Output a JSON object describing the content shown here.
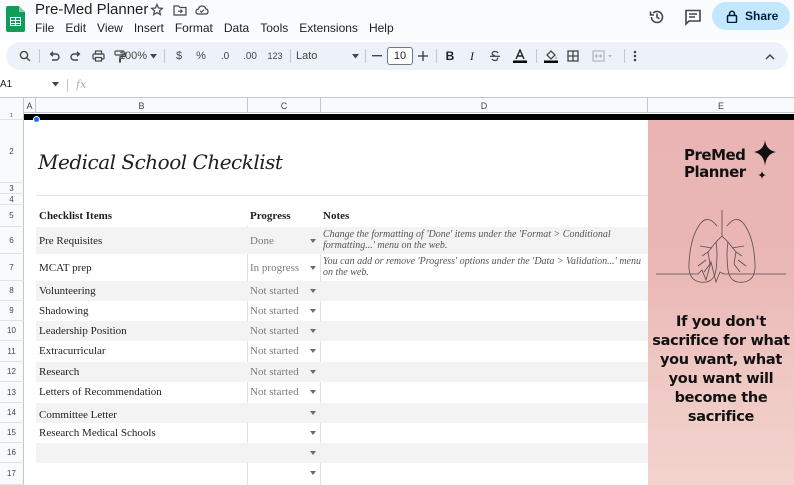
{
  "app": {
    "title": "Pre-Med Planner",
    "share_label": "Share",
    "menu": [
      "File",
      "Edit",
      "View",
      "Insert",
      "Format",
      "Data",
      "Tools",
      "Extensions",
      "Help"
    ]
  },
  "toolbar": {
    "zoom": "100%",
    "currency": "$",
    "percent": "%",
    "decrease_decimals": ".0",
    "increase_decimals": ".00",
    "number_format": "123",
    "font": "Lato",
    "font_size": "10",
    "bold": "B",
    "italic": "I"
  },
  "formula_bar": {
    "name_box": "A1",
    "fx": "fx"
  },
  "columns": [
    "A",
    "B",
    "C",
    "D",
    "E"
  ],
  "rows": [
    "1",
    "2",
    "3",
    "4",
    "5",
    "6",
    "7",
    "8",
    "9",
    "10",
    "11",
    "12",
    "13",
    "14",
    "15",
    "16",
    "17"
  ],
  "sheet": {
    "title": "Medical School Checklist",
    "headers": {
      "items": "Checklist Items",
      "progress": "Progress",
      "notes": "Notes"
    },
    "entries": [
      {
        "item": "Pre Requisites",
        "progress": "Done",
        "note": "Change the formatting of 'Done' items under the 'Format > Conditional formatting...' menu on the web."
      },
      {
        "item": "MCAT prep",
        "progress": "In progress",
        "note": "You can add or remove 'Progress' options under the 'Data > Validation...' menu on the web."
      },
      {
        "item": "Volunteering",
        "progress": "Not started",
        "note": ""
      },
      {
        "item": "Shadowing",
        "progress": "Not started",
        "note": ""
      },
      {
        "item": "Leadership Position",
        "progress": "Not started",
        "note": ""
      },
      {
        "item": "Extracurricular",
        "progress": "Not started",
        "note": ""
      },
      {
        "item": "Research",
        "progress": "Not started",
        "note": ""
      },
      {
        "item": "Letters of Recommendation",
        "progress": "Not started",
        "note": ""
      },
      {
        "item": "Committee Letter",
        "progress": "",
        "note": ""
      },
      {
        "item": "Research Medical Schools",
        "progress": "",
        "note": ""
      },
      {
        "item": "",
        "progress": "",
        "note": ""
      },
      {
        "item": "",
        "progress": "",
        "note": ""
      }
    ]
  },
  "poster": {
    "logo_line1": "PreMed",
    "logo_line2": "Planner",
    "quote": "If you don't sacrifice for what you want, what you want will become the sacrifice"
  }
}
